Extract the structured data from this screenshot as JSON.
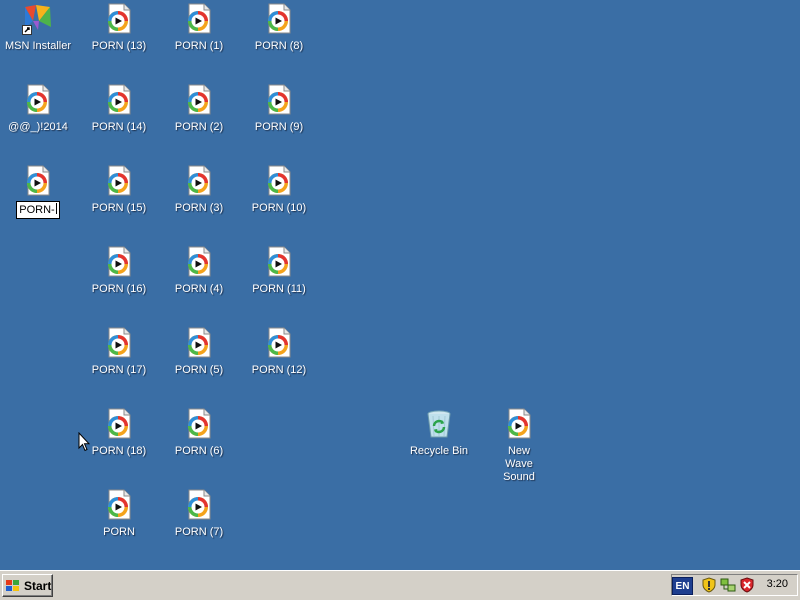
{
  "desktop": {
    "icons": [
      {
        "label": "MSN Installer",
        "kind": "msn-installer-icon"
      },
      {
        "label": "@@_)!2014",
        "kind": "media-file-icon"
      },
      {
        "label": "PORN-",
        "kind": "media-file-icon",
        "editing": true
      },
      {
        "label": "PORN (13)",
        "kind": "media-file-icon"
      },
      {
        "label": "PORN (14)",
        "kind": "media-file-icon"
      },
      {
        "label": "PORN (15)",
        "kind": "media-file-icon"
      },
      {
        "label": "PORN (16)",
        "kind": "media-file-icon"
      },
      {
        "label": "PORN (17)",
        "kind": "media-file-icon"
      },
      {
        "label": "PORN (18)",
        "kind": "media-file-icon"
      },
      {
        "label": "PORN",
        "kind": "media-file-icon"
      },
      {
        "label": "PORN (1)",
        "kind": "media-file-icon"
      },
      {
        "label": "PORN (2)",
        "kind": "media-file-icon"
      },
      {
        "label": "PORN (3)",
        "kind": "media-file-icon"
      },
      {
        "label": "PORN (4)",
        "kind": "media-file-icon"
      },
      {
        "label": "PORN (5)",
        "kind": "media-file-icon"
      },
      {
        "label": "PORN (6)",
        "kind": "media-file-icon"
      },
      {
        "label": "PORN (7)",
        "kind": "media-file-icon"
      },
      {
        "label": "PORN (8)",
        "kind": "media-file-icon"
      },
      {
        "label": "PORN (9)",
        "kind": "media-file-icon"
      },
      {
        "label": "PORN (10)",
        "kind": "media-file-icon"
      },
      {
        "label": "PORN (11)",
        "kind": "media-file-icon"
      },
      {
        "label": "PORN (12)",
        "kind": "media-file-icon"
      },
      {
        "label": "Recycle Bin",
        "kind": "recycle-bin-icon"
      },
      {
        "label": "New Wave Sound",
        "kind": "media-file-icon"
      }
    ]
  },
  "taskbar": {
    "start_label": "Start",
    "language": "EN",
    "clock": "3:20",
    "tray_icons": [
      "security-shield-icon",
      "network-icon",
      "antivirus-icon"
    ]
  },
  "colors": {
    "desktop": "#3a6ea5",
    "taskbar": "#d4d0c8"
  }
}
